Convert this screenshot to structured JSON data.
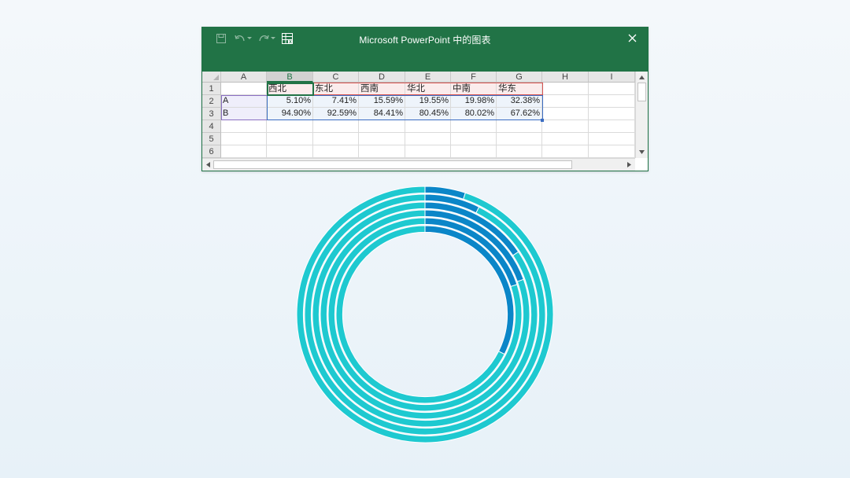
{
  "window": {
    "title": "Microsoft PowerPoint 中的图表",
    "icons": {
      "save": "save-icon",
      "undo": "undo-icon",
      "redo": "redo-icon",
      "edit_data": "edit-data-in-excel-icon",
      "close": "close-icon"
    }
  },
  "sheet": {
    "columns": [
      "A",
      "B",
      "C",
      "D",
      "E",
      "F",
      "G",
      "H",
      "I"
    ],
    "rows": [
      "1",
      "2",
      "3",
      "4",
      "5",
      "6"
    ],
    "header_row": [
      "",
      "西北",
      "东北",
      "西南",
      "华北",
      "中南",
      "华东"
    ],
    "data_rows": [
      [
        "A",
        "5.10%",
        "7.41%",
        "15.59%",
        "19.55%",
        "19.98%",
        "32.38%"
      ],
      [
        "B",
        "94.90%",
        "92.59%",
        "84.41%",
        "80.45%",
        "80.02%",
        "67.62%"
      ]
    ]
  },
  "chart_data": {
    "type": "doughnut",
    "categories": [
      "西北",
      "东北",
      "西南",
      "华北",
      "中南",
      "华东"
    ],
    "series": [
      {
        "name": "A",
        "values": [
          5.1,
          7.41,
          15.59,
          19.55,
          19.98,
          32.38
        ]
      },
      {
        "name": "B",
        "values": [
          94.9,
          92.59,
          84.41,
          80.45,
          80.02,
          67.62
        ]
      }
    ],
    "colors": {
      "A": "#0b86c8",
      "B": "#1ec9d0"
    }
  }
}
